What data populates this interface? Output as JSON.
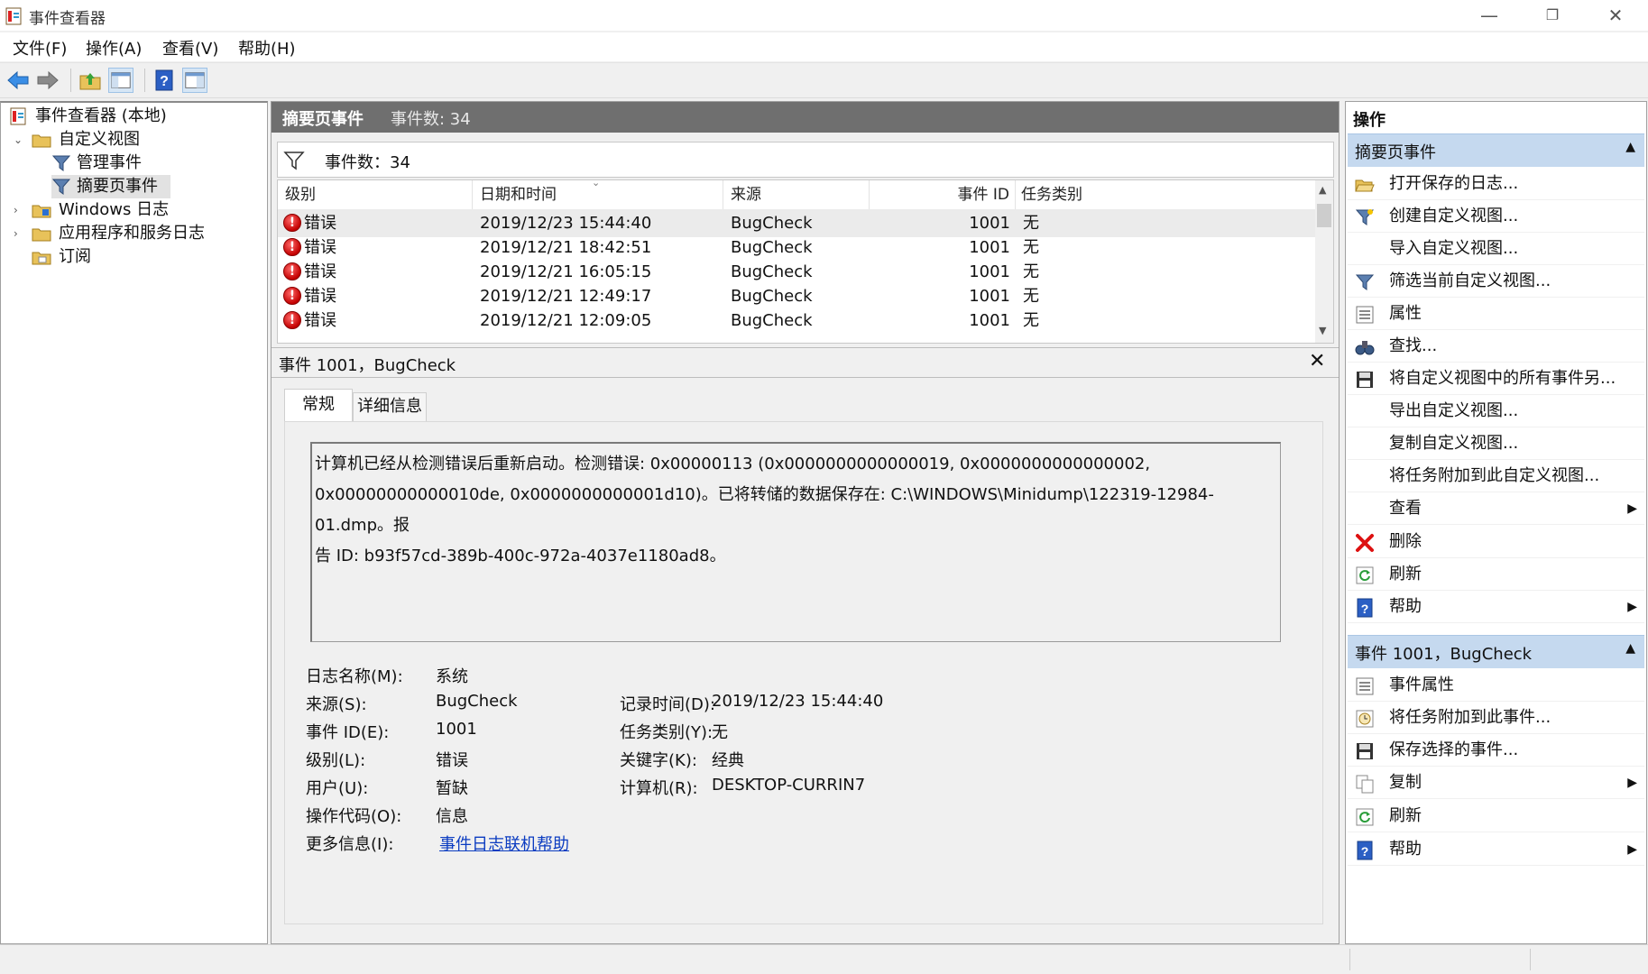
{
  "window": {
    "title": "事件查看器"
  },
  "menu": [
    "文件(F)",
    "操作(A)",
    "查看(V)",
    "帮助(H)"
  ],
  "tree": {
    "root": "事件查看器 (本地)",
    "custom_views": "自定义视图",
    "admin_events": "管理事件",
    "summary_events": "摘要页事件",
    "windows_logs": "Windows 日志",
    "app_service_logs": "应用程序和服务日志",
    "subscriptions": "订阅"
  },
  "center": {
    "header_title": "摘要页事件",
    "header_count": "事件数: 34",
    "filter_text": "事件数：34",
    "columns": [
      "级别",
      "日期和时间",
      "来源",
      "事件 ID",
      "任务类别"
    ],
    "rows": [
      {
        "level": "错误",
        "datetime": "2019/12/23 15:44:40",
        "source": "BugCheck",
        "event_id": "1001",
        "task": "无"
      },
      {
        "level": "错误",
        "datetime": "2019/12/21 18:42:51",
        "source": "BugCheck",
        "event_id": "1001",
        "task": "无"
      },
      {
        "level": "错误",
        "datetime": "2019/12/21 16:05:15",
        "source": "BugCheck",
        "event_id": "1001",
        "task": "无"
      },
      {
        "level": "错误",
        "datetime": "2019/12/21 12:49:17",
        "source": "BugCheck",
        "event_id": "1001",
        "task": "无"
      },
      {
        "level": "错误",
        "datetime": "2019/12/21 12:09:05",
        "source": "BugCheck",
        "event_id": "1001",
        "task": "无"
      }
    ]
  },
  "detail": {
    "title": "事件 1001，BugCheck",
    "tabs": [
      "常规",
      "详细信息"
    ],
    "description_lines": [
      "计算机已经从检测错误后重新启动。检测错误: 0x00000113 (0x0000000000000019, 0x0000000000000002,",
      "0x00000000000010de, 0x0000000000001d10)。已将转储的数据保存在: C:\\WINDOWS\\Minidump\\122319-12984-01.dmp。报",
      "告 ID: b93f57cd-389b-400c-972a-4037e1180ad8。"
    ],
    "props": {
      "log_name_label": "日志名称(M):",
      "log_name": "系统",
      "source_label": "来源(S):",
      "source": "BugCheck",
      "logged_label": "记录时间(D):",
      "logged": "2019/12/23 15:44:40",
      "event_id_label": "事件 ID(E):",
      "event_id": "1001",
      "task_label": "任务类别(Y):",
      "task": "无",
      "level_label": "级别(L):",
      "level": "错误",
      "keywords_label": "关键字(K):",
      "keywords": "经典",
      "user_label": "用户(U):",
      "user": "暂缺",
      "computer_label": "计算机(R):",
      "computer": "DESKTOP-CURRIN7",
      "opcode_label": "操作代码(O):",
      "opcode": "信息",
      "more_info_label": "更多信息(I):",
      "more_info": "事件日志联机帮助"
    }
  },
  "actions": {
    "title": "操作",
    "section1": "摘要页事件",
    "items1": [
      {
        "label": "打开保存的日志...",
        "icon": "open-folder-icon"
      },
      {
        "label": "创建自定义视图...",
        "icon": "filter-icon"
      },
      {
        "label": "导入自定义视图...",
        "icon": ""
      },
      {
        "label": "筛选当前自定义视图...",
        "icon": "filter-icon"
      },
      {
        "label": "属性",
        "icon": "properties-icon"
      },
      {
        "label": "查找...",
        "icon": "binoculars-icon"
      },
      {
        "label": "将自定义视图中的所有事件另...",
        "icon": "save-icon"
      },
      {
        "label": "导出自定义视图...",
        "icon": ""
      },
      {
        "label": "复制自定义视图...",
        "icon": ""
      },
      {
        "label": "将任务附加到此自定义视图...",
        "icon": ""
      },
      {
        "label": "查看",
        "icon": ""
      },
      {
        "label": "删除",
        "icon": "delete-icon"
      },
      {
        "label": "刷新",
        "icon": "refresh-icon"
      },
      {
        "label": "帮助",
        "icon": "help-icon"
      }
    ],
    "section2": "事件 1001，BugCheck",
    "items2": [
      {
        "label": "事件属性",
        "icon": "properties-icon"
      },
      {
        "label": "将任务附加到此事件...",
        "icon": "task-icon"
      },
      {
        "label": "保存选择的事件...",
        "icon": "save-icon"
      },
      {
        "label": "复制",
        "icon": "copy-icon"
      },
      {
        "label": "刷新",
        "icon": "refresh-icon"
      },
      {
        "label": "帮助",
        "icon": "help-icon"
      }
    ]
  },
  "colors": {
    "header_gray": "#6f6f6f",
    "section_blue": "#c5d9ef",
    "link": "#0b3cc1",
    "error_red": "#c40000"
  }
}
